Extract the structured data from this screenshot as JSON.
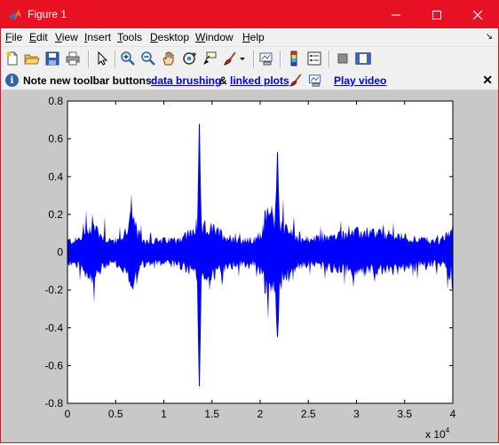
{
  "window": {
    "title": "Figure 1",
    "title_bar_color": "#e81123"
  },
  "menu": {
    "items": [
      {
        "hotkey": "F",
        "rest": "ile"
      },
      {
        "hotkey": "E",
        "rest": "dit"
      },
      {
        "hotkey": "V",
        "rest": "iew"
      },
      {
        "hotkey": "I",
        "rest": "nsert"
      },
      {
        "hotkey": "T",
        "rest": "ools"
      },
      {
        "hotkey": "D",
        "rest": "esktop"
      },
      {
        "hotkey": "W",
        "rest": "indow"
      },
      {
        "hotkey": "H",
        "rest": "elp"
      }
    ],
    "dock_arrow": "↘"
  },
  "toolbar": {
    "buttons": [
      "new-figure-icon",
      "open-file-icon",
      "save-icon",
      "print-icon",
      "edit-plot-arrow-icon",
      "zoom-in-icon",
      "zoom-out-icon",
      "pan-hand-icon",
      "rotate-3d-icon",
      "data-cursor-icon",
      "brush-icon",
      "link-plot-icon",
      "colorbar-icon",
      "legend-icon",
      "hide-plot-tools-icon",
      "show-plot-tools-icon"
    ]
  },
  "infobar": {
    "message": "Note new toolbar buttons:",
    "link_brushing": "data brushing",
    "ampersand": "&",
    "link_linked": "linked plots",
    "link_video": "Play video",
    "close": "✕"
  },
  "chart_data": {
    "type": "line",
    "series": [
      {
        "color": "#0000ff"
      }
    ],
    "title": "",
    "xlabel": "",
    "ylabel": "",
    "xlim": [
      0,
      40000
    ],
    "ylim": [
      -0.8,
      0.8
    ],
    "x_ticks": [
      "0",
      "0.5",
      "1",
      "1.5",
      "2",
      "2.5",
      "3",
      "3.5",
      "4"
    ],
    "y_ticks": [
      "0.8",
      "0.6",
      "0.4",
      "0.2",
      "0",
      "-0.2",
      "-0.4",
      "-0.6",
      "-0.8"
    ],
    "x_multiplier": "x 10",
    "x_multiplier_exp": "4",
    "grid": false,
    "description_points": [
      {
        "x": 13700,
        "max": 0.68,
        "min": -0.71
      },
      {
        "x": 21800,
        "max": 0.53,
        "min": -0.45
      },
      {
        "x": 20500,
        "max": 0.22,
        "min": -0.22
      },
      {
        "x": 6600,
        "max": 0.22,
        "min": -0.18
      },
      {
        "x": 40000,
        "max": 0.18,
        "min": -0.18
      }
    ]
  }
}
